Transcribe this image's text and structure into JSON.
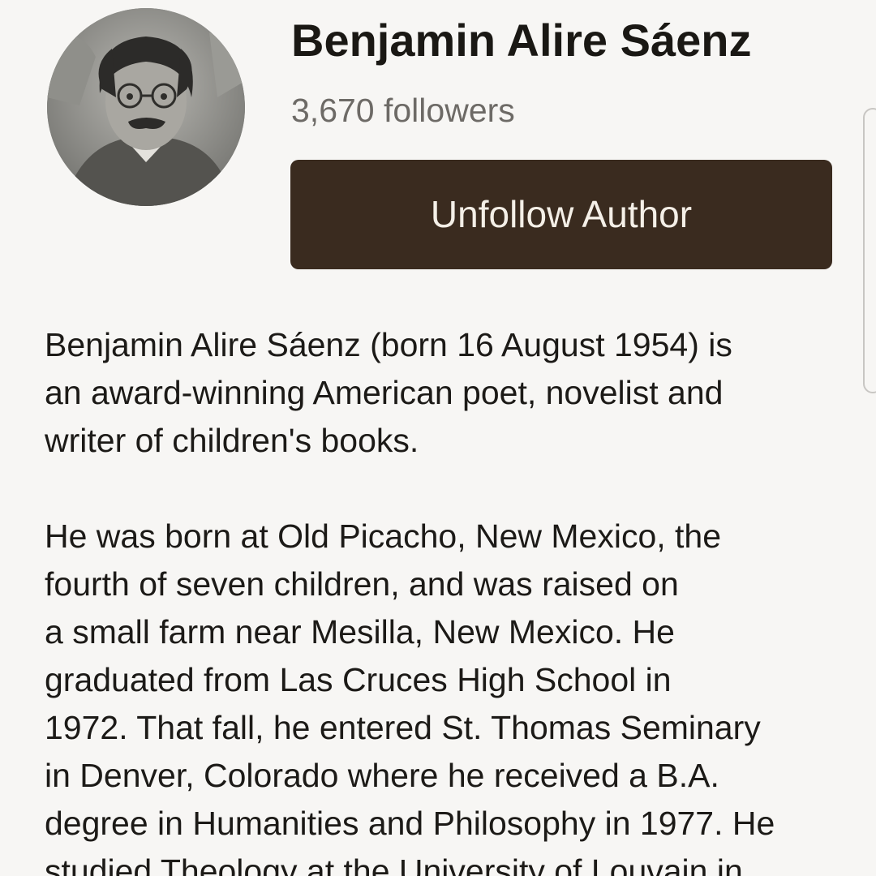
{
  "author": {
    "name": "Benjamin Alire Sáenz",
    "followers": "3,670 followers",
    "unfollow_label": "Unfollow Author"
  },
  "bio": {
    "para1_lines": [
      "Benjamin Alire Sáenz (born 16 August 1954) is",
      "an award-winning American poet, novelist and",
      "writer of children's books."
    ],
    "para2_lines": [
      "He was born at Old Picacho, New Mexico, the",
      "fourth of seven children, and was raised on",
      "a small farm near Mesilla, New Mexico. He",
      "graduated from Las Cruces High School in",
      "1972. That fall, he entered St. Thomas Seminary",
      "in Denver, Colorado where he received a B.A.",
      "degree in Humanities and Philosophy in 1977. He",
      "studied Theology at the University of Louvain in"
    ]
  },
  "colors": {
    "button_bg": "#3a2b1f",
    "button_text": "#f4efe7",
    "secondary_text": "#6d6a66",
    "page_bg": "#f7f6f4"
  }
}
